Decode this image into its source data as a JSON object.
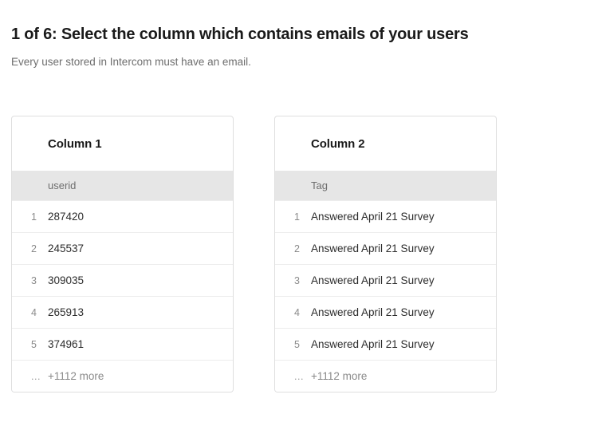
{
  "header": {
    "title": "1 of 6: Select the column which contains emails of your users",
    "subtitle": "Every user stored in Intercom must have an email."
  },
  "columns": [
    {
      "title": "Column 1",
      "source_header": "userid",
      "rows": [
        {
          "index": "1",
          "value": "287420"
        },
        {
          "index": "2",
          "value": "245537"
        },
        {
          "index": "3",
          "value": "309035"
        },
        {
          "index": "4",
          "value": "265913"
        },
        {
          "index": "5",
          "value": "374961"
        }
      ],
      "more_index": "...",
      "more_label": "+1112 more"
    },
    {
      "title": "Column 2",
      "source_header": "Tag",
      "rows": [
        {
          "index": "1",
          "value": "Answered April 21 Survey"
        },
        {
          "index": "2",
          "value": "Answered April 21 Survey"
        },
        {
          "index": "3",
          "value": "Answered April 21 Survey"
        },
        {
          "index": "4",
          "value": "Answered April 21 Survey"
        },
        {
          "index": "5",
          "value": "Answered April 21 Survey"
        }
      ],
      "more_index": "...",
      "more_label": "+1112 more"
    }
  ],
  "colors": {
    "page_background": "#ffffff",
    "title_text": "#1a1a1a",
    "subtitle_text": "#6e6e6e",
    "card_border": "#dededf",
    "header_band_background": "#e6e6e6",
    "row_divider": "#ededed"
  }
}
